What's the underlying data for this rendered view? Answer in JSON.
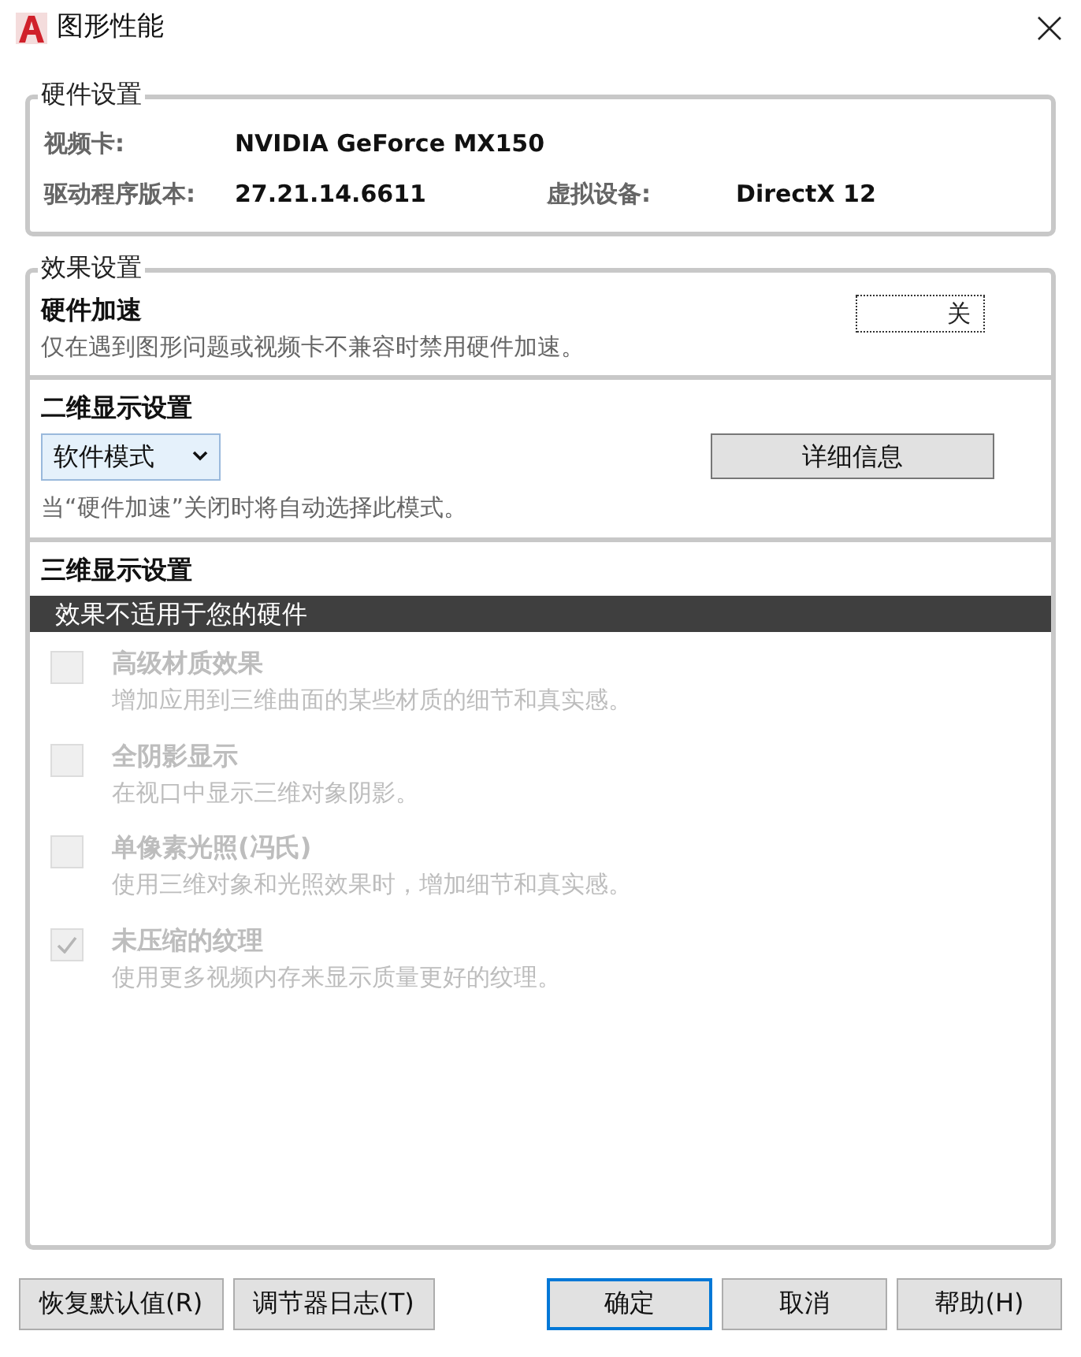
{
  "window": {
    "title": "图形性能"
  },
  "hardware": {
    "legend": "硬件设置",
    "rows": [
      {
        "label": "视频卡:",
        "value": "NVIDIA GeForce MX150"
      },
      {
        "label": "驱动程序版本:",
        "value": "27.21.14.6611",
        "label2": "虚拟设备:",
        "value2": "DirectX 12"
      }
    ]
  },
  "effects": {
    "legend": "效果设置",
    "acceleration": {
      "title": "硬件加速",
      "description": "仅在遇到图形问题或视频卡不兼容时禁用硬件加速。",
      "toggle": {
        "label": "关",
        "on": false
      }
    },
    "display_2d": {
      "title": "二维显示设置",
      "dropdown": {
        "value": "软件模式"
      },
      "details_button": "详细信息",
      "note": "当“硬件加速”关闭时将自动选择此模式。"
    },
    "display_3d": {
      "title": "三维显示设置",
      "banner": "效果不适用于您的硬件",
      "options": [
        {
          "title": "高级材质效果",
          "description": "增加应用到三维曲面的某些材质的细节和真实感。",
          "checked": false,
          "disabled": true
        },
        {
          "title": "全阴影显示",
          "description": "在视口中显示三维对象阴影。",
          "checked": false,
          "disabled": true
        },
        {
          "title": "单像素光照(冯氏)",
          "description": "使用三维对象和光照效果时，增加细节和真实感。",
          "checked": false,
          "disabled": true
        },
        {
          "title": "未压缩的纹理",
          "description": "使用更多视频内存来显示质量更好的纹理。",
          "checked": true,
          "disabled": true
        }
      ]
    }
  },
  "buttons": [
    {
      "label": "恢复默认值(R)",
      "kind": "secondary"
    },
    {
      "label": "调节器日志(T)",
      "kind": "secondary"
    },
    {
      "label": "确定",
      "kind": "default"
    },
    {
      "label": "取消",
      "kind": "secondary"
    },
    {
      "label": "帮助(H)",
      "kind": "secondary"
    }
  ]
}
